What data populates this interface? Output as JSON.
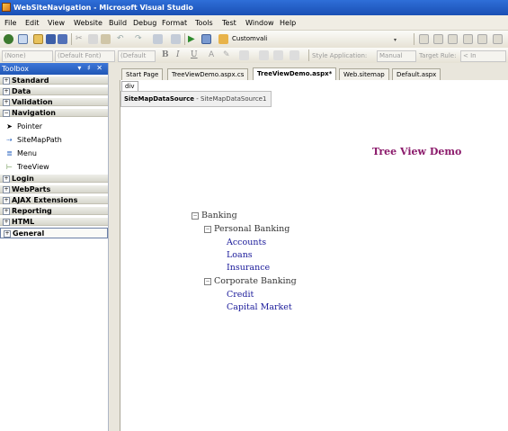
{
  "window": {
    "title": "WebSiteNavigation - Microsoft Visual Studio"
  },
  "menu": [
    "File",
    "Edit",
    "View",
    "Website",
    "Build",
    "Debug",
    "Format",
    "Tools",
    "Test",
    "Window",
    "Help"
  ],
  "toolbar": {
    "config_combo": "Customvali"
  },
  "format_toolbar": {
    "block_format": "(None)",
    "font_name": "(Default Font)",
    "font_size": "(Default",
    "bold": "B",
    "italic": "I",
    "underline": "U",
    "style_application_label": "Style Application:",
    "style_application_value": "Manual",
    "target_rule_label": "Target Rule:",
    "target_rule_value": "< In"
  },
  "toolbox": {
    "title": "Toolbox",
    "controls": "▾ ♯ ✕",
    "categories": {
      "standard": "Standard",
      "data": "Data",
      "validation": "Validation",
      "navigation": "Navigation",
      "login": "Login",
      "webparts": "WebParts",
      "ajax": "AJAX Extensions",
      "reporting": "Reporting",
      "html": "HTML",
      "general": "General"
    },
    "nav_items": {
      "pointer": "Pointer",
      "sitemappath": "SiteMapPath",
      "menu": "Menu",
      "treeview": "TreeView"
    }
  },
  "tabs": [
    "Start Page",
    "TreeViewDemo.aspx.cs",
    "TreeViewDemo.aspx*",
    "Web.sitemap",
    "Default.aspx"
  ],
  "design": {
    "div_tag": "div",
    "datasource_type": "SiteMapDataSource",
    "datasource_id": " - SiteMapDataSource1",
    "page_title": "Tree View Demo",
    "tree": {
      "root": "Banking",
      "personal": "Personal Banking",
      "accounts": "Accounts",
      "loans": "Loans",
      "insurance": "Insurance",
      "corporate": "Corporate Banking",
      "credit": "Credit",
      "capital": "Capital Market"
    }
  }
}
